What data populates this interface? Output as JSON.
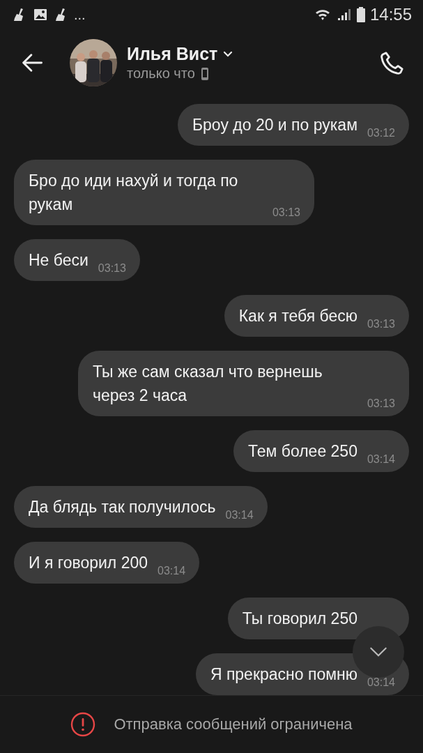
{
  "status_bar": {
    "more": "...",
    "time": "14:55"
  },
  "header": {
    "name": "Илья Вист",
    "presence": "только что"
  },
  "messages": [
    {
      "kind": "outgoing",
      "text": "Броу до 20 и по рукам",
      "time": "03:12"
    },
    {
      "kind": "incoming",
      "text": "Бро до иди нахуй и тогда по рукам",
      "time": "03:13"
    },
    {
      "kind": "incoming",
      "text": "Не беси",
      "time": "03:13"
    },
    {
      "kind": "outgoing",
      "text": "Как я тебя бесю",
      "time": "03:13"
    },
    {
      "kind": "outgoing",
      "text": "Ты же сам сказал что вернешь через 2 часа",
      "time": "03:13"
    },
    {
      "kind": "outgoing",
      "text": "Тем более 250",
      "time": "03:14"
    },
    {
      "kind": "incoming",
      "text": "Да блядь так получилось",
      "time": "03:14"
    },
    {
      "kind": "incoming",
      "text": "И я говорил 200",
      "time": "03:14"
    },
    {
      "kind": "outgoing",
      "text": "Ты говорил 250"
    },
    {
      "kind": "outgoing",
      "text": "Я прекрасно помню",
      "time": "03:14"
    }
  ],
  "footer": {
    "notice": "Отправка сообщений ограничена"
  }
}
